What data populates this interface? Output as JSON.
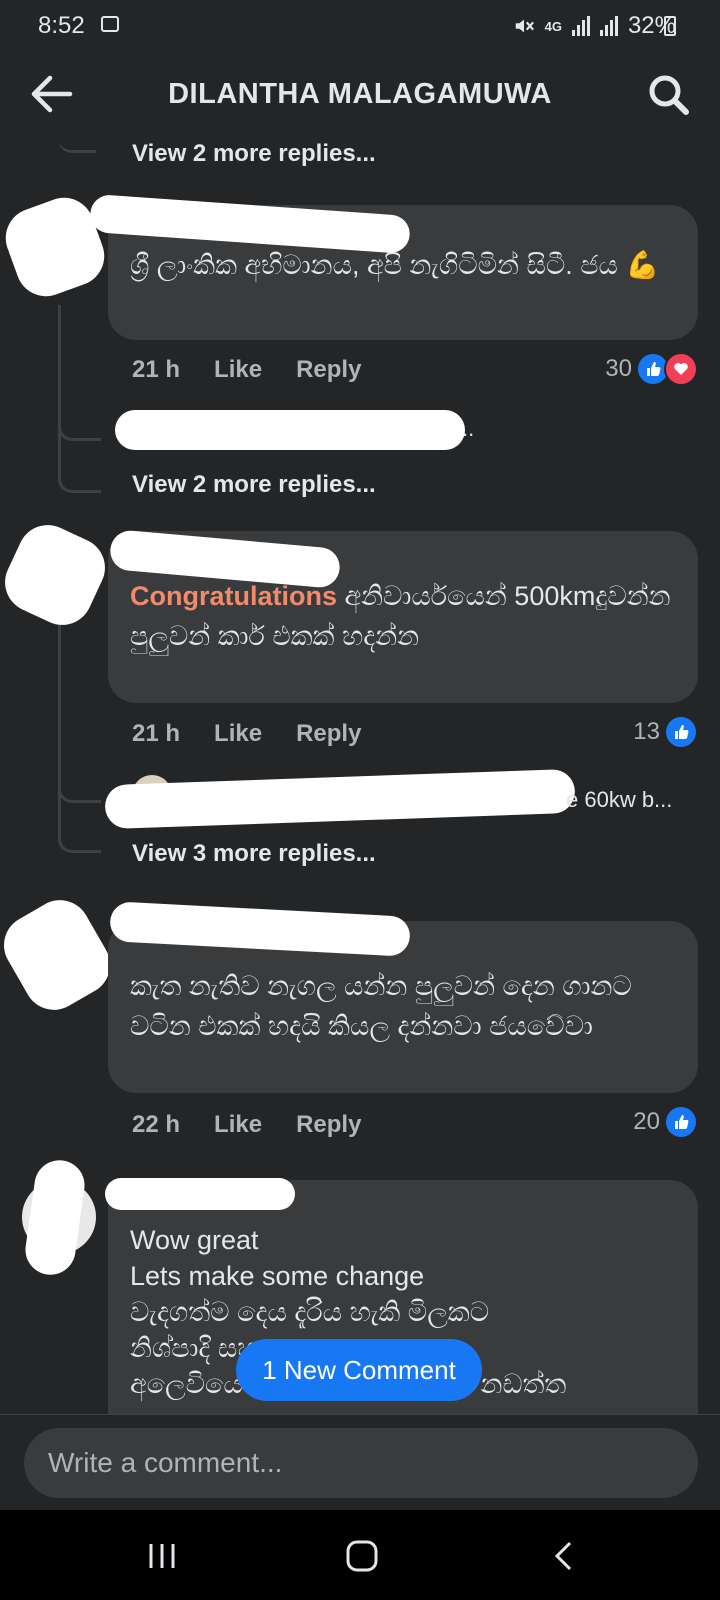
{
  "status_bar": {
    "time": "8:52",
    "network": "4G",
    "battery": "32%"
  },
  "header": {
    "title": "DILANTHA MALAGAMUWA"
  },
  "thread": [
    {
      "view_more": "View 2 more replies..."
    },
    {
      "text": "ශ්‍රී ලාංකික අභිමානය, අපි නැගිටිමින් සිටී. ජය 💪",
      "time": "21 h",
      "like": "Like",
      "reply": "Reply",
      "reaction_count": "30",
      "reactions": [
        "like",
        "love"
      ],
      "reply_preview_suffix": "..",
      "view_more": "View 2 more replies..."
    },
    {
      "highlight": "Congratulations",
      "text": " අනිවාර්යයෙන් 500kmදුවන්න පුලුවන් කාර් එකක් හදන්න",
      "time": "21 h",
      "like": "Like",
      "reply": "Reply",
      "reaction_count": "13",
      "reactions": [
        "like"
      ],
      "reply_preview_suffix": "e 60kw b...",
      "view_more": "View 3 more replies..."
    },
    {
      "text": "කැත නැතිව නැගල යන්න පුලුවන් දෙන ගානට වටින එකක් හදයි කියල දන්නවා ජයවේවා",
      "time": "22 h",
      "like": "Like",
      "reply": "Reply",
      "reaction_count": "20",
      "reactions": [
        "like"
      ]
    },
    {
      "text": "Wow great\nLets make some change\nවැදගත්ම දෙය දැරිය හැකි මිලකට\nනිශ්පාදි                          සහ\nඅලෙවියෙන් පස සේවාවන් සහ නඩත්ත"
    }
  ],
  "new_comment_pill": "1 New Comment",
  "composer": {
    "placeholder": "Write a comment..."
  },
  "colors": {
    "background": "#242526",
    "bubble": "#3a3b3c",
    "accent": "#1877f2",
    "highlight": "#f28b6b"
  },
  "icons": [
    "back-arrow-icon",
    "search-icon",
    "like-reaction-icon",
    "love-reaction-icon",
    "recent-apps-icon",
    "home-icon",
    "nav-back-icon"
  ]
}
